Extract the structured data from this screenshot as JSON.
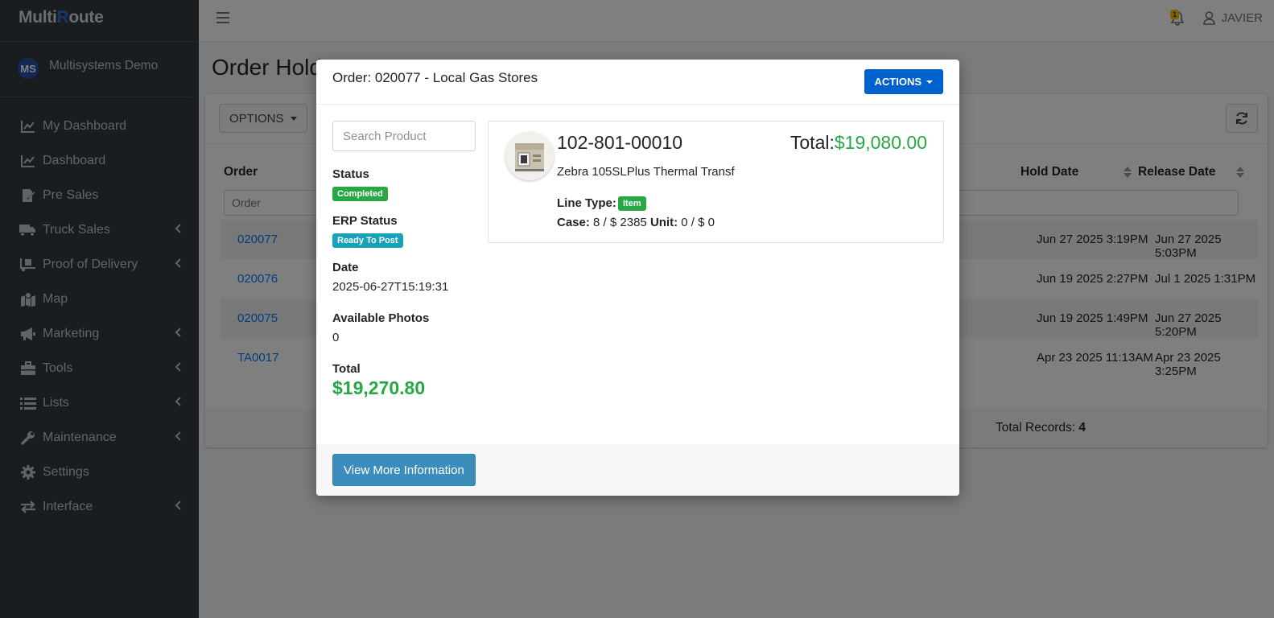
{
  "brand": {
    "part1": "Multi",
    "part2": "R",
    "part3": "oute"
  },
  "user": {
    "initials": "MS",
    "company": "Multisystems Demo"
  },
  "nav": [
    {
      "label": "My Dashboard",
      "icon": "chart-line-icon",
      "chevron": false
    },
    {
      "label": "Dashboard",
      "icon": "chart-line-icon",
      "chevron": false
    },
    {
      "label": "Pre Sales",
      "icon": "file-signature-icon",
      "chevron": false
    },
    {
      "label": "Truck Sales",
      "icon": "truck-icon",
      "chevron": true
    },
    {
      "label": "Proof of Delivery",
      "icon": "truck-loading-icon",
      "chevron": true
    },
    {
      "label": "Map",
      "icon": "map-marked-icon",
      "chevron": false
    },
    {
      "label": "Marketing",
      "icon": "bullhorn-icon",
      "chevron": true
    },
    {
      "label": "Tools",
      "icon": "toolbox-icon",
      "chevron": true
    },
    {
      "label": "Lists",
      "icon": "list-icon",
      "chevron": true
    },
    {
      "label": "Maintenance",
      "icon": "wrench-icon",
      "chevron": true
    },
    {
      "label": "Settings",
      "icon": "gear-icon",
      "chevron": false
    },
    {
      "label": "Interface",
      "icon": "exchange-icon",
      "chevron": true
    }
  ],
  "header": {
    "notifications": "1",
    "username": "JAVIER"
  },
  "page": {
    "title": "Order Hold",
    "options_label": "OPTIONS",
    "columns": {
      "order": "Order",
      "hold_date": "Hold Date",
      "release_date": "Release Date"
    },
    "filter_placeholder": "Order",
    "rows": [
      {
        "order": "020077",
        "hold": "Jun 27 2025 3:19PM",
        "release": "Jun 27 2025 5:03PM"
      },
      {
        "order": "020076",
        "hold": "Jun 19 2025 2:27PM",
        "release": "Jul 1 2025 1:31PM"
      },
      {
        "order": "020075",
        "hold": "Jun 19 2025 1:49PM",
        "release": "Jun 27 2025 5:20PM"
      },
      {
        "order": "TA0017",
        "hold": "Apr 23 2025 11:13AM",
        "release": "Apr 23 2025 3:25PM"
      }
    ],
    "total_records_label": "Total Records:",
    "total_records": "4"
  },
  "modal": {
    "title": "Order: 020077 - Local Gas Stores",
    "actions_label": "ACTIONS",
    "search_placeholder": "Search Product",
    "status_label": "Status",
    "status": "Completed",
    "erp_status_label": "ERP Status",
    "erp_status": "Ready To Post",
    "date_label": "Date",
    "date": "2025-06-27T15:19:31",
    "photos_label": "Available Photos",
    "photos": "0",
    "total_label": "Total",
    "total": "$19,270.80",
    "product": {
      "code": "102-801-00010",
      "description": "Zebra 105SLPlus Thermal Transf",
      "total_label": "Total:",
      "total": "$19,080.00",
      "line_type_label": "Line Type:",
      "line_type": "Item",
      "case_label": "Case:",
      "case_value": "8 / $ 2385",
      "unit_label": "Unit:",
      "unit_value": "0 / $ 0"
    },
    "view_more_label": "View More Information"
  },
  "colors": {
    "sidebar": "#343a40",
    "accent_blue": "#007bff",
    "success": "#28a745",
    "info": "#17a2b8",
    "primary_dark": "#0062cc",
    "lte_blue": "#3c8dbc"
  }
}
